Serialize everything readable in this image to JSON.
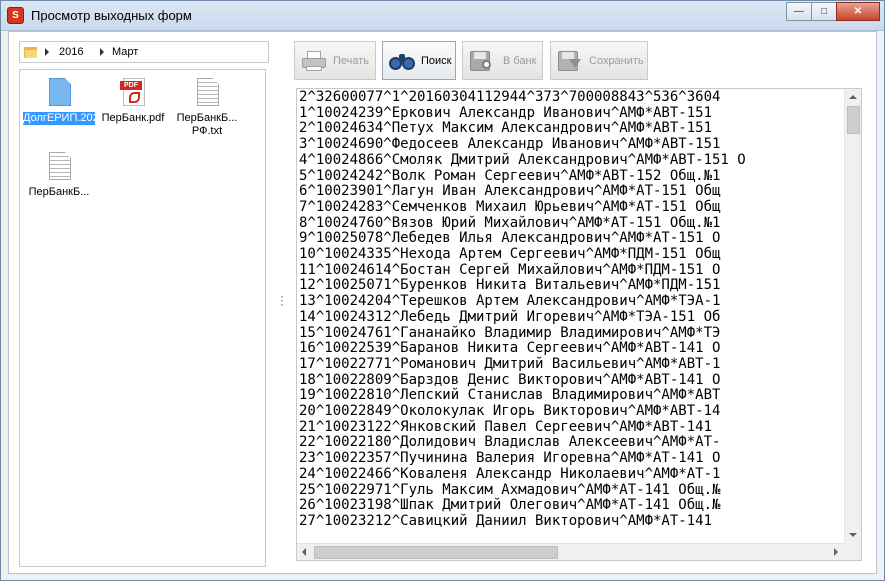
{
  "window": {
    "title": "Просмотр выходных форм",
    "app_icon_text": "S"
  },
  "window_buttons": {
    "minimize": "—",
    "maximize": "□",
    "close": "✕"
  },
  "breadcrumb": {
    "items": [
      "2016",
      "Март"
    ]
  },
  "files": [
    {
      "name": "ДолгЕРИП.202",
      "icon": "generic-file-icon",
      "selected": true
    },
    {
      "name": "ПерБанк.pdf",
      "icon": "pdf-icon",
      "selected": false
    },
    {
      "name": "ПерБанкБ... РФ.txt",
      "icon": "text-file-icon",
      "selected": false
    },
    {
      "name": "ПерБанкБ...",
      "icon": "text-file-icon",
      "selected": false
    }
  ],
  "toolbar": {
    "print_label": "Печать",
    "search_label": "Поиск",
    "to_bank_label": "В банк",
    "save_label": "Сохранить"
  },
  "content": {
    "lines": [
      "2^32600077^1^20160304112944^373^700008843^536^3604",
      "1^10024239^Еркович Александр Иванович^АМФ*АВТ-151",
      "2^10024634^Петух Максим Александрович^АМФ*АВТ-151",
      "3^10024690^Федосеев Александр Иванович^АМФ*АВТ-151",
      "4^10024866^Смоляк Дмитрий Александрович^АМФ*АВТ-151 О",
      "5^10024242^Волк Роман Сергеевич^АМФ*АВТ-152 Общ.№1",
      "6^10023901^Лагун Иван Александрович^АМФ*АТ-151 Общ",
      "7^10024283^Семченков Михаил Юрьевич^АМФ*АТ-151 Общ",
      "8^10024760^Вязов Юрий Михайлович^АМФ*АТ-151 Общ.№1",
      "9^10025078^Лебедев Илья Александрович^АМФ*АТ-151 О",
      "10^10024335^Неходa Артем Сергеевич^АМФ*ПДМ-151 Общ",
      "11^10024614^Бостан Сергей Михайлович^АМФ*ПДМ-151 О",
      "12^10025071^Буренков Никита Витальевич^АМФ*ПДМ-151",
      "13^10024204^Терешков Артем Александрович^АМФ*ТЭА-1",
      "14^10024312^Лебедь Дмитрий Игоревич^АМФ*ТЭА-151 Об",
      "15^10024761^Гананайко Владимир Владимирович^АМФ*ТЭ",
      "16^10022539^Баранов Никита Сергеевич^АМФ*АВТ-141 О",
      "17^10022771^Романович Дмитрий Васильевич^АМФ*АВТ-1",
      "18^10022809^Барздов Денис Викторович^АМФ*АВТ-141 О",
      "19^10022810^Лепский Станислав Владимирович^АМФ*АВТ",
      "20^10022849^Околокулак Игорь Викторович^АМФ*АВТ-14",
      "21^10023122^Янковский Павел Сергеевич^АМФ*АВТ-141",
      "22^10022180^Долидович Владислав Алексеевич^АМФ*АТ-",
      "23^10022357^Пучинина Валерия Игоревна^АМФ*АТ-141 О",
      "24^10022466^Коваленя Александр Николаевич^АМФ*АТ-1",
      "25^10022971^Гуль Максим Ахмадович^АМФ*АТ-141 Общ.№",
      "26^10023198^Шпак Дмитрий Олегович^АМФ*АТ-141 Общ.№",
      "27^10023212^Савицкий Даниил Викторович^АМФ*АТ-141"
    ]
  },
  "colors": {
    "selection": "#3399ff",
    "disabled_text": "#9a9a9a"
  }
}
